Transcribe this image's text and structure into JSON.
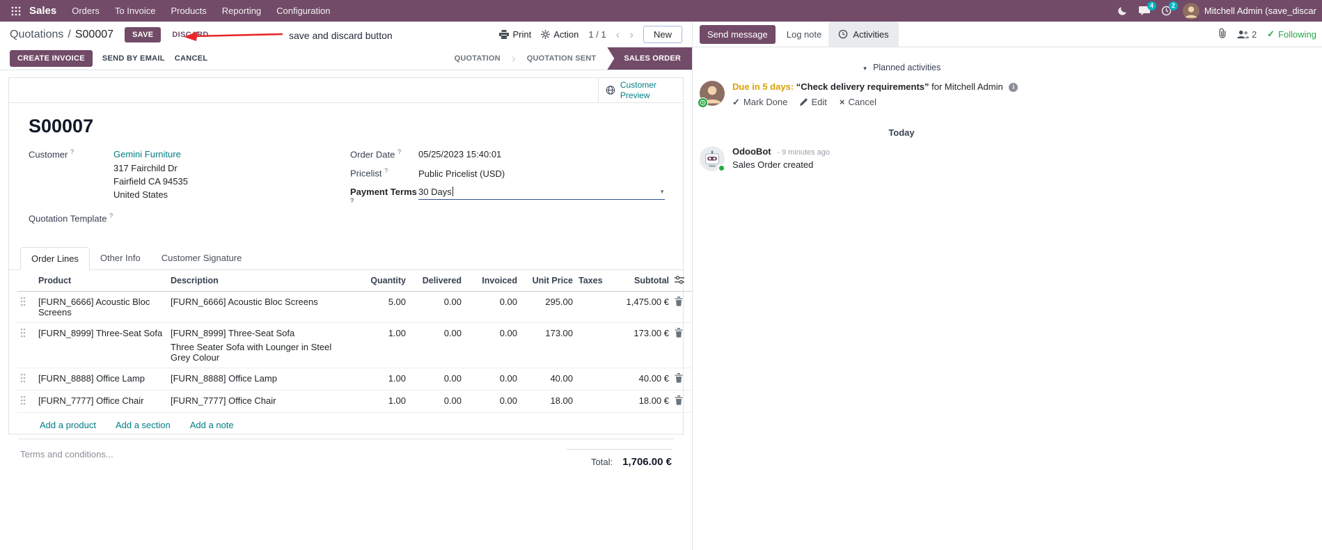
{
  "colors": {
    "brand": "#714B67",
    "link_teal": "#017e84",
    "highlight_value_blue": "#2962d9",
    "following_green": "#28a745",
    "due_orange": "#d9a300",
    "badge_teal": "#00b5c0",
    "annotation_red": "#e8262a"
  },
  "nav": {
    "app_name": "Sales",
    "menus": [
      {
        "label": "Orders"
      },
      {
        "label": "To Invoice"
      },
      {
        "label": "Products"
      },
      {
        "label": "Reporting"
      },
      {
        "label": "Configuration"
      }
    ],
    "messages_badge": "4",
    "activities_badge": "2",
    "user_name": "Mitchell Admin (save_discar"
  },
  "breadcrumb": {
    "parent": "Quotations",
    "separator": "/",
    "current": "S00007"
  },
  "control_panel": {
    "save_label": "SAVE",
    "discard_label": "DISCARD",
    "print_label": "Print",
    "action_label": "Action",
    "pager": "1 / 1",
    "prev": "‹",
    "next": "›",
    "new_label": "New"
  },
  "annotation": {
    "text": "save and discard button"
  },
  "statusbar": {
    "create_invoice": "CREATE INVOICE",
    "send_by_email": "SEND BY EMAIL",
    "cancel": "CANCEL",
    "stages": [
      {
        "label": "QUOTATION"
      },
      {
        "label": "QUOTATION SENT"
      },
      {
        "label": "SALES ORDER"
      }
    ]
  },
  "form": {
    "customer_preview": "Customer Preview",
    "title": "S00007",
    "help": "?",
    "customer": {
      "label": "Customer",
      "name": "Gemini Furniture",
      "address": [
        "317 Fairchild Dr",
        "Fairfield CA 94535",
        "United States"
      ]
    },
    "quotation_template_label": "Quotation Template",
    "order_date": {
      "label": "Order Date",
      "value": "05/25/2023 15:40:01"
    },
    "pricelist": {
      "label": "Pricelist",
      "value": "Public Pricelist (USD)"
    },
    "payment_terms": {
      "label": "Payment Terms",
      "value": "30 Days"
    },
    "tabs": [
      {
        "label": "Order Lines"
      },
      {
        "label": "Other Info"
      },
      {
        "label": "Customer Signature"
      }
    ],
    "order_lines": {
      "columns": [
        "Product",
        "Description",
        "Quantity",
        "Delivered",
        "Invoiced",
        "Unit Price",
        "Taxes",
        "Subtotal"
      ],
      "rows": [
        {
          "product": "[FURN_6666] Acoustic Bloc Screens",
          "desc1": "[FURN_6666] Acoustic Bloc Screens",
          "desc2": "",
          "qty": "5.00",
          "delivered": "0.00",
          "invoiced": "0.00",
          "price": "295.00",
          "taxes": "",
          "subtotal": "1,475.00 €"
        },
        {
          "product": "[FURN_8999] Three-Seat Sofa",
          "desc1": "[FURN_8999] Three-Seat Sofa",
          "desc2": "Three Seater Sofa with Lounger in Steel Grey Colour",
          "qty": "1.00",
          "delivered": "0.00",
          "invoiced": "0.00",
          "price": "173.00",
          "taxes": "",
          "subtotal": "173.00 €"
        },
        {
          "product": "[FURN_8888] Office Lamp",
          "desc1": "[FURN_8888] Office Lamp",
          "desc2": "",
          "qty": "1.00",
          "delivered": "0.00",
          "invoiced": "0.00",
          "price": "40.00",
          "taxes": "",
          "subtotal": "40.00 €"
        },
        {
          "product": "[FURN_7777] Office Chair",
          "desc1": "[FURN_7777] Office Chair",
          "desc2": "",
          "qty": "1.00",
          "delivered": "0.00",
          "invoiced": "0.00",
          "price": "18.00",
          "taxes": "",
          "subtotal": "18.00 €"
        }
      ],
      "add_links": [
        {
          "label": "Add a product"
        },
        {
          "label": "Add a section"
        },
        {
          "label": "Add a note"
        }
      ]
    },
    "terms_placeholder": "Terms and conditions...",
    "total": {
      "label": "Total:",
      "value": "1,706.00 €"
    }
  },
  "chatter": {
    "send_message": "Send message",
    "log_note": "Log note",
    "activities_tab": "Activities",
    "followers_count": "2",
    "following_label": "Following",
    "planned_header": "Planned activities",
    "activity": {
      "due": "Due in 5 days:",
      "summary": "“Check delivery requirements”",
      "for_text": "for Mitchell Admin",
      "actions": [
        {
          "label": "Mark Done"
        },
        {
          "label": "Edit"
        },
        {
          "label": "Cancel"
        }
      ]
    },
    "today_label": "Today",
    "message": {
      "author": "OdooBot",
      "time": "- 9 minutes ago",
      "body": "Sales Order created"
    }
  }
}
